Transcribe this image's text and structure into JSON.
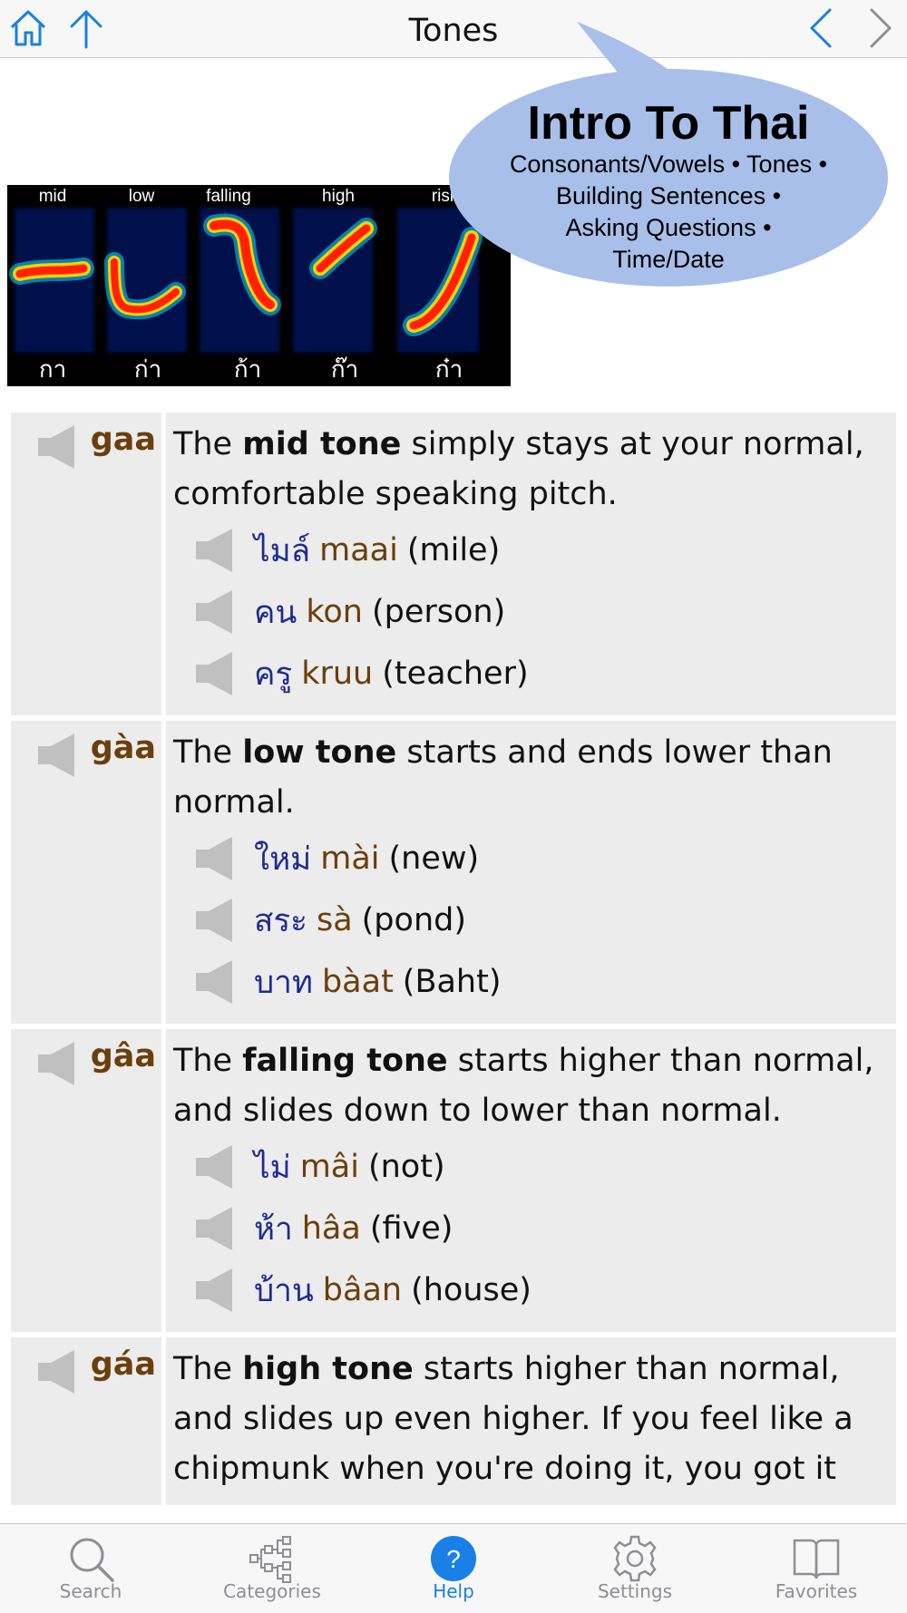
{
  "header": {
    "title": "Tones"
  },
  "nav_icons": [
    "home-icon",
    "arrow-up-icon",
    "chevron-left-icon",
    "chevron-right-icon"
  ],
  "spectrogram": {
    "labels": [
      "mid",
      "low",
      "falling",
      "high",
      "risi"
    ],
    "thai": [
      "กา",
      "ก่า",
      "ก้า",
      "ก๊า",
      "ก๋า"
    ]
  },
  "bubble": {
    "title": "Intro To Thai",
    "subtitle_lines": [
      "Consonants/Vowels • Tones •",
      "Building Sentences •",
      "Asking Questions •",
      "Time/Date"
    ]
  },
  "sections": [
    {
      "tone_word": "gaa",
      "desc": [
        "The ",
        "mid tone",
        " simply stays at your normal, comfortable speaking pitch."
      ],
      "examples": [
        {
          "thai": "ไมล์",
          "roman": "maai",
          "gloss": "(mile)"
        },
        {
          "thai": "คน",
          "roman": "kon",
          "gloss": "(person)"
        },
        {
          "thai": "ครู",
          "roman": "kruu",
          "gloss": "(teacher)"
        }
      ]
    },
    {
      "tone_word": "gàa",
      "desc": [
        "The ",
        "low tone",
        " starts and ends lower than normal."
      ],
      "examples": [
        {
          "thai": "ใหม่",
          "roman": "mài",
          "gloss": "(new)"
        },
        {
          "thai": "สระ",
          "roman": "sà",
          "gloss": "(pond)"
        },
        {
          "thai": "บาท",
          "roman": "bàat",
          "gloss": "(Baht)"
        }
      ]
    },
    {
      "tone_word": "gâa",
      "desc": [
        "The ",
        "falling tone",
        " starts higher than normal, and slides down to lower than normal."
      ],
      "examples": [
        {
          "thai": "ไม่",
          "roman": "mâi",
          "gloss": "(not)"
        },
        {
          "thai": "ห้า",
          "roman": "hâa",
          "gloss": "(five)"
        },
        {
          "thai": "บ้าน",
          "roman": "bâan",
          "gloss": "(house)"
        }
      ]
    },
    {
      "tone_word": "gáa",
      "desc": [
        "The ",
        "high tone",
        " starts higher than normal, and slides up even higher. If you feel like a chipmunk when you're doing it, you got it"
      ],
      "examples": []
    }
  ],
  "tabs": [
    {
      "label": "Search",
      "icon": "search-icon"
    },
    {
      "label": "Categories",
      "icon": "categories-icon"
    },
    {
      "label": "Help",
      "icon": "help-icon",
      "active": true
    },
    {
      "label": "Settings",
      "icon": "gear-icon"
    },
    {
      "label": "Favorites",
      "icon": "book-icon"
    }
  ],
  "colors": {
    "accent": "#1a7fe6",
    "tone_word": "#6b3f0c",
    "thai_text": "#1e2b91",
    "section_bg": "#ececec",
    "bubble": "#a8bfea"
  }
}
